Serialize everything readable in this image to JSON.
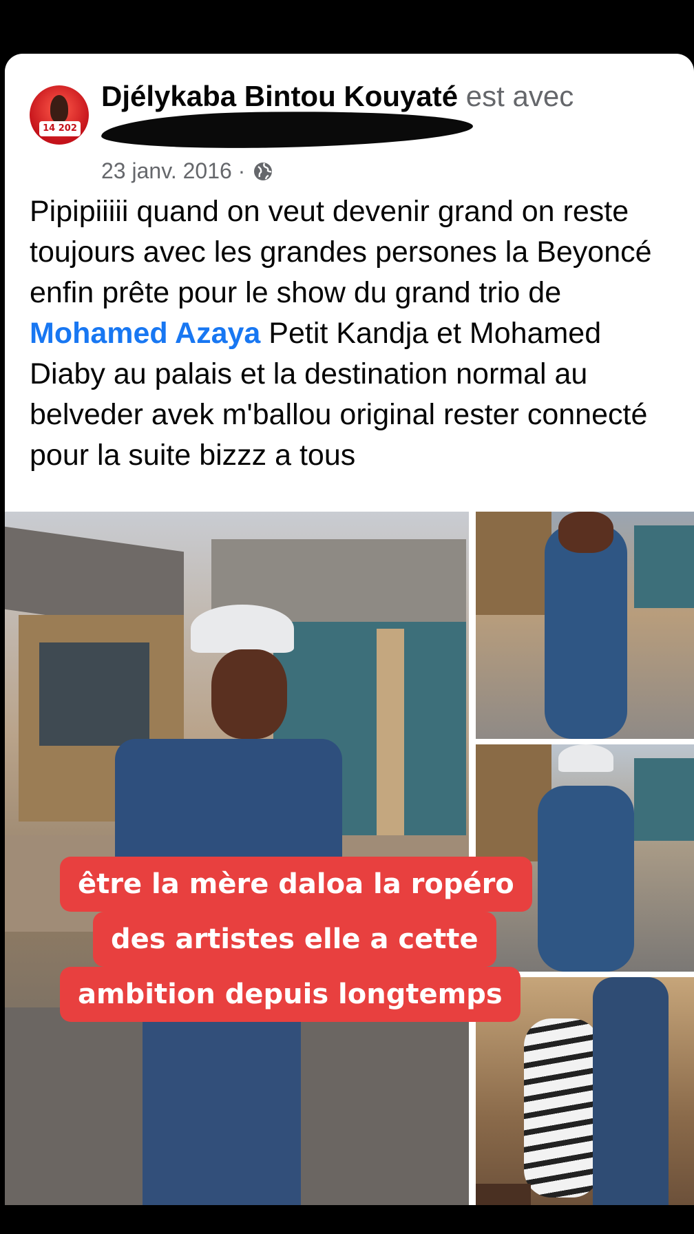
{
  "post": {
    "author_name": "Djélykaba Bintou Kouyaté",
    "with_text": " est avec",
    "date": "23 janv. 2016 ·",
    "privacy_icon": "globe-icon",
    "text_part1": "Pipipiiiii quand on veut devenir grand on reste toujours avec les grandes persones la Beyoncé enfin prête pour le show du grand trio de ",
    "mention": "Mohamed Azaya",
    "text_part2": " Petit Kandja et Mohamed Diaby au palais et la destination normal au belveder avek m'ballou original rester connecté pour la suite bizzz a tous"
  },
  "avatar": {
    "badge": "14 202"
  },
  "overlay_caption": {
    "line1": "être la mère daloa la ropéro",
    "line2": "des artistes elle a cette",
    "line3": "ambition depuis longtemps"
  },
  "colors": {
    "mention": "#1877f2",
    "caption_bg": "#e8403f",
    "meta": "#65676b"
  }
}
